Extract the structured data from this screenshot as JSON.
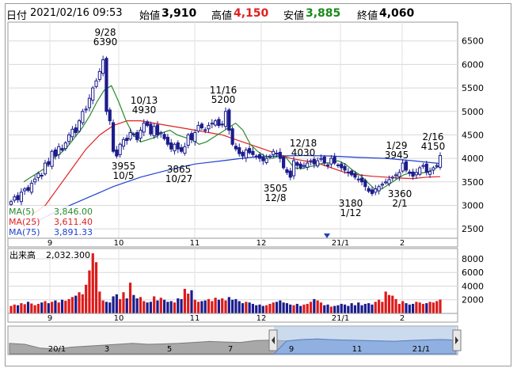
{
  "header": {
    "date_label": "日付",
    "date_value": "2021/02/16 09:53",
    "open_label": "始値",
    "open_value": "3,910",
    "high_label": "高値",
    "high_value": "4,150",
    "low_label": "安値",
    "low_value": "3,885",
    "close_label": "終値",
    "close_value": "4,060"
  },
  "legend": {
    "ma5_label": "MA(5)",
    "ma5_value": "3,846.00",
    "ma25_label": "MA(25)",
    "ma25_value": "3,611.40",
    "ma75_label": "MA(75)",
    "ma75_value": "3,891.33"
  },
  "volume_label": "出来高",
  "volume_value": "2,032.300",
  "colors": {
    "up": "#1c1c8c",
    "down": "#dd1a1a",
    "ma5": "#2a8a2a",
    "ma25": "#e02020",
    "ma75": "#2040d0",
    "high": "#e02020",
    "low": "#1a8a1a"
  },
  "chart_data": [
    {
      "type": "candlestick",
      "y_ticks": [
        "6500",
        "6000",
        "5500",
        "5000",
        "4500",
        "4000",
        "3500",
        "3000",
        "2500"
      ],
      "ylim": [
        2300,
        6900
      ],
      "x_tick_labels": [
        "9",
        "10",
        "11",
        "12",
        "21/1",
        "2"
      ],
      "annotations": [
        {
          "date": "9/28",
          "value": "6390"
        },
        {
          "date": "10/13",
          "value": "4930"
        },
        {
          "date": "11/16",
          "value": "5200"
        },
        {
          "date": "12/18",
          "value": "4030"
        },
        {
          "date": "1/29",
          "value": "3945"
        },
        {
          "date": "2/16",
          "value": "4150"
        },
        {
          "date": "10/5",
          "value": "3955"
        },
        {
          "date": "10/27",
          "value": "3865"
        },
        {
          "date": "12/8",
          "value": "3505"
        },
        {
          "date": "1/12",
          "value": "3180"
        },
        {
          "date": "2/1",
          "value": "3360"
        }
      ],
      "close": [
        3080,
        3180,
        3120,
        3280,
        3350,
        3320,
        3470,
        3560,
        3680,
        3640,
        3900,
        3870,
        4150,
        4050,
        4250,
        4180,
        4330,
        4500,
        4620,
        4550,
        4800,
        5000,
        5050,
        5280,
        5500,
        5650,
        5850,
        6100,
        5000,
        4800,
        4150,
        4050,
        4300,
        4400,
        4380,
        4550,
        4520,
        4400,
        4600,
        4750,
        4700,
        4520,
        4680,
        4500,
        4550,
        4420,
        4300,
        4200,
        4300,
        4200,
        4150,
        4250,
        4500,
        4400,
        4550,
        4700,
        4650,
        4600,
        4700,
        4750,
        4800,
        4700,
        4720,
        5000,
        4600,
        4300,
        4200,
        4100,
        4050,
        4180,
        4120,
        4080,
        4050,
        4000,
        3950,
        4000,
        4050,
        4150,
        4100,
        4000,
        3800,
        3700,
        3600,
        3950,
        3850,
        3800,
        3850,
        3900,
        3950,
        3880,
        3950,
        4000,
        3900,
        3850,
        4000,
        3900,
        3850,
        3800,
        3750,
        3700,
        3650,
        3600,
        3550,
        3500,
        3400,
        3300,
        3250,
        3350,
        3400,
        3450,
        3500,
        3550,
        3600,
        3650,
        3700,
        3900,
        3750,
        3680,
        3620,
        3700,
        3800,
        3850,
        3700,
        3720,
        3800,
        3850,
        4060
      ],
      "ma5_values": [
        3500,
        3600,
        3700,
        3800,
        4000,
        4100,
        4250,
        4450,
        4650,
        4900,
        5200,
        5450,
        5550,
        5200,
        4800,
        4500,
        4350,
        4400,
        4450,
        4550,
        4600,
        4500,
        4450,
        4400,
        4300,
        4350,
        4450,
        4550,
        4650,
        4750,
        4600,
        4300,
        4150,
        4050,
        4000,
        4050,
        4000,
        3800,
        3780,
        3820,
        3850,
        3900,
        3900,
        3950,
        3880,
        3750,
        3650,
        3500,
        3350,
        3350,
        3450,
        3550,
        3650,
        3700,
        3680,
        3700,
        3760,
        3846
      ],
      "ma25_values": [
        2800,
        3000,
        3400,
        3800,
        4200,
        4500,
        4700,
        4800,
        4800,
        4750,
        4700,
        4650,
        4600,
        4550,
        4500,
        4400,
        4300,
        4200,
        4100,
        4000,
        3950,
        3900,
        3800,
        3700,
        3650,
        3620,
        3600,
        3580,
        3570,
        3600,
        3611
      ],
      "ma75_values": [
        2600,
        2900,
        3150,
        3400,
        3600,
        3750,
        3880,
        3950,
        4020,
        4050,
        4060,
        4050,
        4020,
        4000,
        3950,
        3890
      ],
      "volume_ticks": [
        "8000",
        "6000",
        "4000",
        "2000"
      ],
      "volume": [
        1100,
        1300,
        1200,
        1500,
        1350,
        1700,
        1450,
        1200,
        1400,
        1600,
        1800,
        1500,
        1700,
        1900,
        1600,
        2000,
        1850,
        2100,
        2400,
        2600,
        3100,
        2800,
        4200,
        6300,
        8800,
        7500,
        3200,
        1900,
        1700,
        1600,
        2500,
        2800,
        2100,
        3100,
        2200,
        4500,
        2700,
        2200,
        2400,
        1800,
        1600,
        1700,
        2500,
        1900,
        2300,
        2000,
        1700,
        1800,
        1600,
        2200,
        2100,
        3600,
        2900,
        3400,
        2000,
        1700,
        1800,
        1900,
        2100,
        1800,
        2300,
        2000,
        2200,
        1900,
        2400,
        2000,
        2100,
        1800,
        1500,
        1700,
        1600,
        1400,
        1200,
        1300,
        1100,
        1200,
        1400,
        1600,
        1700,
        1900,
        1600,
        1500,
        1300,
        1200,
        1400,
        1100,
        1300,
        1400,
        1700,
        2100,
        1900,
        1600,
        1200,
        1300,
        1000,
        1100,
        1200,
        1400,
        1300,
        1100,
        1500,
        1200,
        1600,
        1200,
        1400,
        1500,
        1300,
        1700,
        2000,
        1700,
        3200,
        2700,
        2600,
        2100,
        1400,
        1800,
        1500,
        1300,
        1400,
        1700,
        1600,
        1400,
        1500,
        1700,
        1600,
        1800,
        2032
      ],
      "navigator_tick_labels": [
        "20/1",
        "3",
        "5",
        "7",
        "9",
        "11",
        "21/1"
      ]
    }
  ]
}
